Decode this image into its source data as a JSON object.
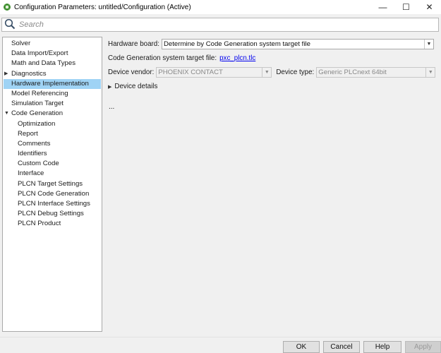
{
  "window": {
    "title": "Configuration Parameters: untitled/Configuration (Active)",
    "minimize": "—",
    "maximize": "☐",
    "close": "✕"
  },
  "search": {
    "placeholder": "Search"
  },
  "tree": {
    "items": [
      {
        "label": "Solver",
        "level": 0,
        "expander": ""
      },
      {
        "label": "Data Import/Export",
        "level": 0,
        "expander": ""
      },
      {
        "label": "Math and Data Types",
        "level": 0,
        "expander": ""
      },
      {
        "label": "Diagnostics",
        "level": 0,
        "expander": "▶"
      },
      {
        "label": "Hardware Implementation",
        "level": 0,
        "expander": "",
        "selected": true
      },
      {
        "label": "Model Referencing",
        "level": 0,
        "expander": ""
      },
      {
        "label": "Simulation Target",
        "level": 0,
        "expander": ""
      },
      {
        "label": "Code Generation",
        "level": 0,
        "expander": "▼"
      },
      {
        "label": "Optimization",
        "level": 1
      },
      {
        "label": "Report",
        "level": 1
      },
      {
        "label": "Comments",
        "level": 1
      },
      {
        "label": "Identifiers",
        "level": 1
      },
      {
        "label": "Custom Code",
        "level": 1
      },
      {
        "label": "Interface",
        "level": 1
      },
      {
        "label": "PLCN Target Settings",
        "level": 1
      },
      {
        "label": "PLCN Code Generation",
        "level": 1
      },
      {
        "label": "PLCN Interface Settings",
        "level": 1
      },
      {
        "label": "PLCN Debug Settings",
        "level": 1
      },
      {
        "label": "PLCN Product",
        "level": 1
      }
    ]
  },
  "content": {
    "hardware_board_label": "Hardware board:",
    "hardware_board_value": "Determine by Code Generation system target file",
    "target_file_label": "Code Generation system target file:",
    "target_file_link": "pxc_plcn.tlc",
    "device_vendor_label": "Device vendor:",
    "device_vendor_value": "PHOENIX CONTACT",
    "device_type_label": "Device type:",
    "device_type_value": "Generic PLCnext 64bit",
    "device_details_label": "Device details",
    "device_details_arrow": "▶",
    "ellipsis": "...",
    "dropdown_arrow": "▼"
  },
  "footer": {
    "ok": "OK",
    "cancel": "Cancel",
    "help": "Help",
    "apply": "Apply"
  }
}
